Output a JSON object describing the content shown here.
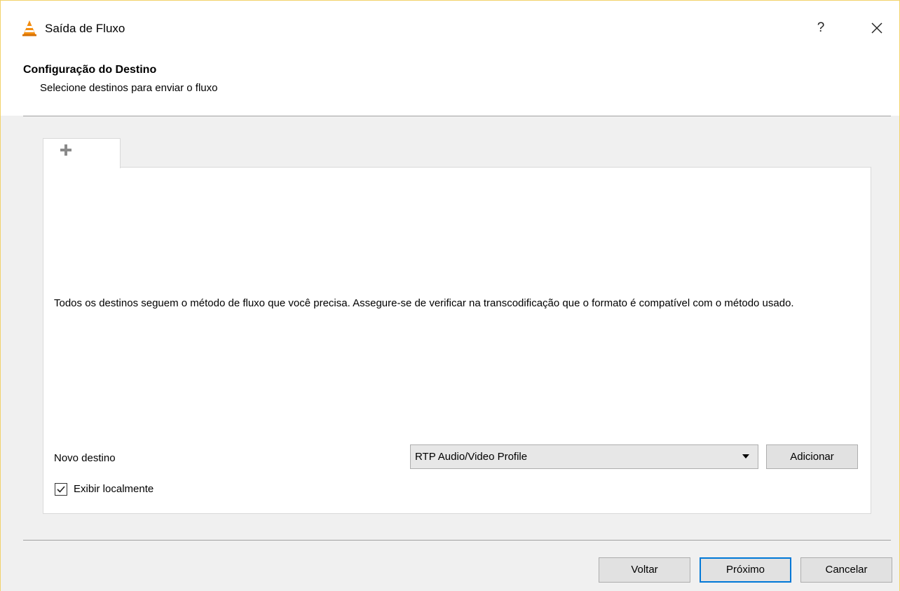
{
  "window": {
    "title": "Saída de Fluxo",
    "help_label": "?",
    "accent_color": "#f2d26b"
  },
  "header": {
    "title": "Configuração do Destino",
    "subtitle": "Selecione destinos para enviar o fluxo"
  },
  "tabs": [
    {
      "icon": "plus-icon",
      "selected": true
    }
  ],
  "panel": {
    "info_text": "Todos os destinos seguem o método de fluxo que você precisa. Assegure-se de verificar na transcodificação que o formato é compatível com o método usado.",
    "new_destination_label": "Novo destino",
    "destination_select_value": "RTP Audio/Video Profile",
    "add_button_label": "Adicionar",
    "display_locally_label": "Exibir localmente",
    "display_locally_checked": true
  },
  "footer": {
    "back_label": "Voltar",
    "next_label": "Próximo",
    "cancel_label": "Cancelar",
    "default_button_color": "#0078d7"
  }
}
